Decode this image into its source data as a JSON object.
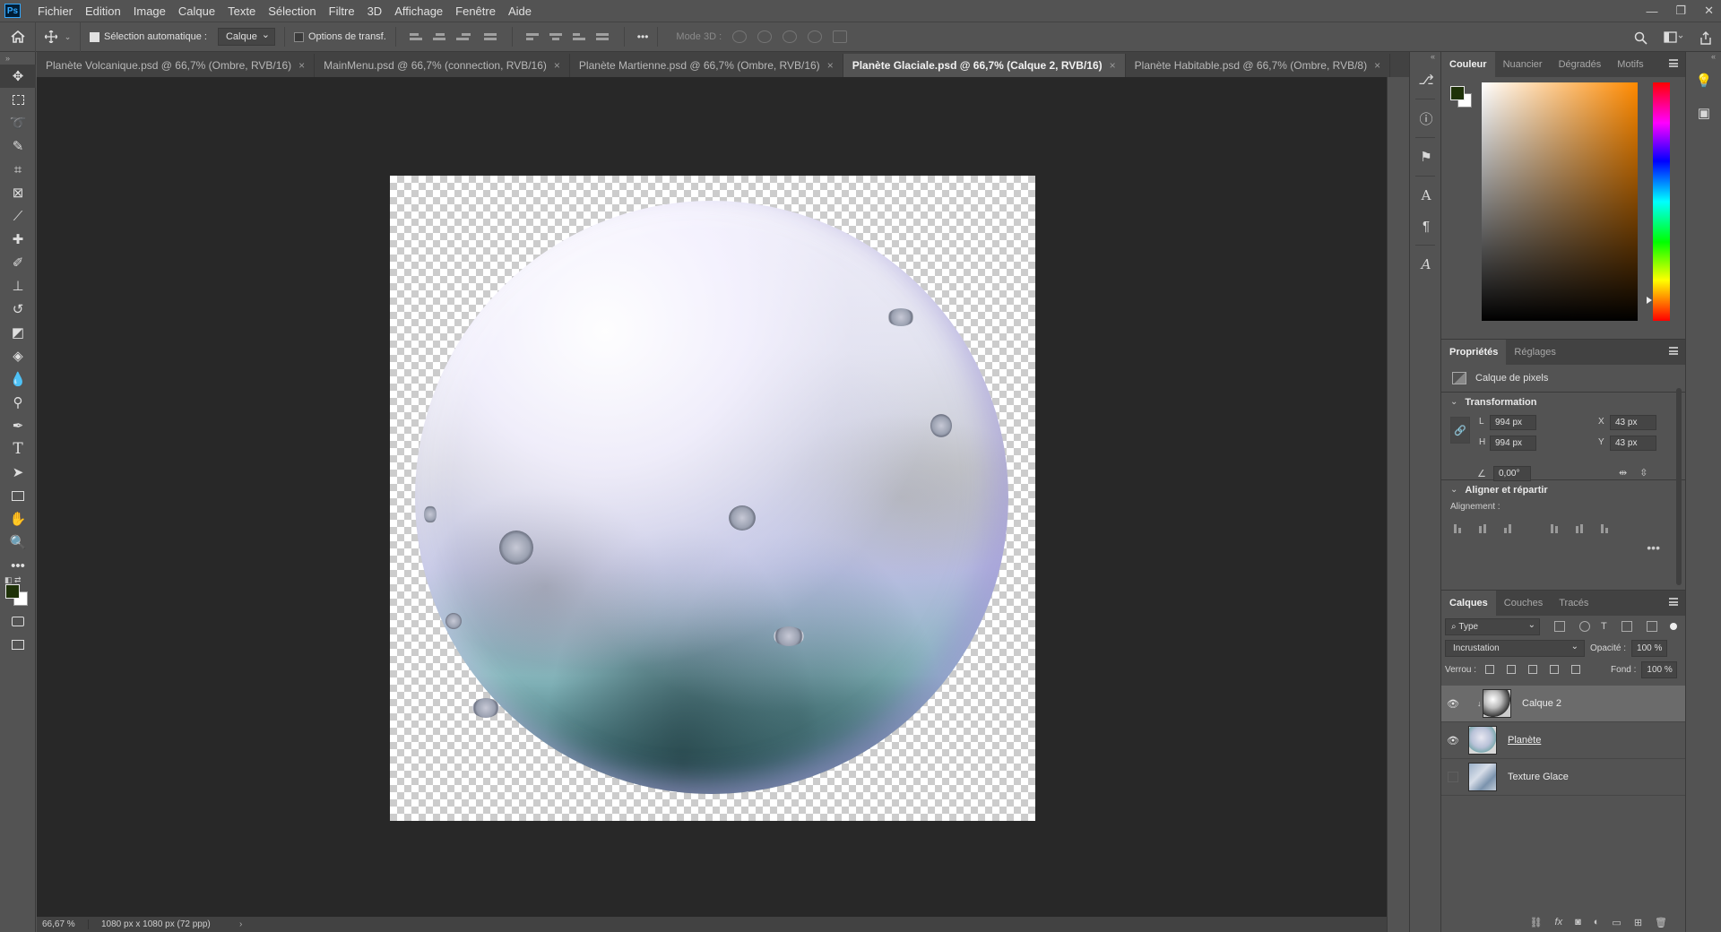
{
  "app": {
    "logo": "Ps",
    "menu": [
      "Fichier",
      "Edition",
      "Image",
      "Calque",
      "Texte",
      "Sélection",
      "Filtre",
      "3D",
      "Affichage",
      "Fenêtre",
      "Aide"
    ],
    "window_controls": [
      "—",
      "❐",
      "✕"
    ]
  },
  "options_bar": {
    "auto_select_label": "Sélection automatique :",
    "auto_select_checked": true,
    "auto_select_target": "Calque",
    "transform_options_label": "Options de transf.",
    "more": "•••",
    "mode3d_label": "Mode 3D :"
  },
  "tabs": [
    {
      "label": "Planète Volcanique.psd @ 66,7% (Ombre, RVB/16)",
      "active": false
    },
    {
      "label": "MainMenu.psd @ 66,7% (connection, RVB/16)",
      "active": false
    },
    {
      "label": "Planète Martienne.psd @ 66,7% (Ombre, RVB/16)",
      "active": false
    },
    {
      "label": "Planète Glaciale.psd @ 66,7% (Calque 2, RVB/16)",
      "active": true
    },
    {
      "label": "Planète Habitable.psd @ 66,7% (Ombre, RVB/8)",
      "active": false
    }
  ],
  "tab_close": "×",
  "status": {
    "zoom": "66,67 %",
    "doc_info": "1080 px x 1080 px (72 ppp)",
    "arrow": "›"
  },
  "colors": {
    "foreground": "#1f3209",
    "background": "#ffffff",
    "ps_blue": "#31a8ff"
  },
  "color_panel": {
    "tabs": [
      "Couleur",
      "Nuancier",
      "Dégradés",
      "Motifs"
    ]
  },
  "properties_panel": {
    "tabs": [
      "Propriétés",
      "Réglages"
    ],
    "layer_kind": "Calque de pixels",
    "transform_title": "Transformation",
    "w_label": "L",
    "w_value": "994 px",
    "h_label": "H",
    "h_value": "994 px",
    "x_label": "X",
    "x_value": "43 px",
    "y_label": "Y",
    "y_value": "43 px",
    "angle_value": "0,00°",
    "align_title": "Aligner et répartir",
    "align_label": "Alignement :",
    "more": "•••"
  },
  "layers_panel": {
    "tabs": [
      "Calques",
      "Couches",
      "Tracés"
    ],
    "filter_label": "Type",
    "blend_mode": "Incrustation",
    "opacity_label": "Opacité :",
    "opacity_value": "100 %",
    "lock_label": "Verrou :",
    "fill_label": "Fond :",
    "fill_value": "100 %",
    "layers": [
      {
        "name": "Calque 2",
        "visible": true,
        "selected": true,
        "linked_style": false
      },
      {
        "name": "Planète",
        "visible": true,
        "selected": false,
        "linked_style": true
      },
      {
        "name": "Texture Glace",
        "visible": false,
        "selected": false,
        "linked_style": false
      }
    ],
    "footer_icons": [
      "link-icon",
      "fx-icon",
      "mask-icon",
      "adjustment-icon",
      "group-icon",
      "new-layer-icon",
      "trash-icon"
    ]
  },
  "icons": {
    "left_tools": [
      "move-tool-icon",
      "marquee-tool-icon",
      "lasso-tool-icon",
      "quick-selection-icon",
      "crop-tool-icon",
      "frame-tool-icon",
      "eyedropper-icon",
      "healing-brush-icon",
      "brush-tool-icon",
      "clone-stamp-icon",
      "history-brush-icon",
      "eraser-icon",
      "paint-bucket-icon",
      "blur-tool-icon",
      "dodge-tool-icon",
      "pen-tool-icon",
      "type-tool-icon",
      "path-selection-icon",
      "rectangle-tool-icon",
      "hand-tool-icon",
      "zoom-tool-icon",
      "more-tools-icon"
    ]
  }
}
